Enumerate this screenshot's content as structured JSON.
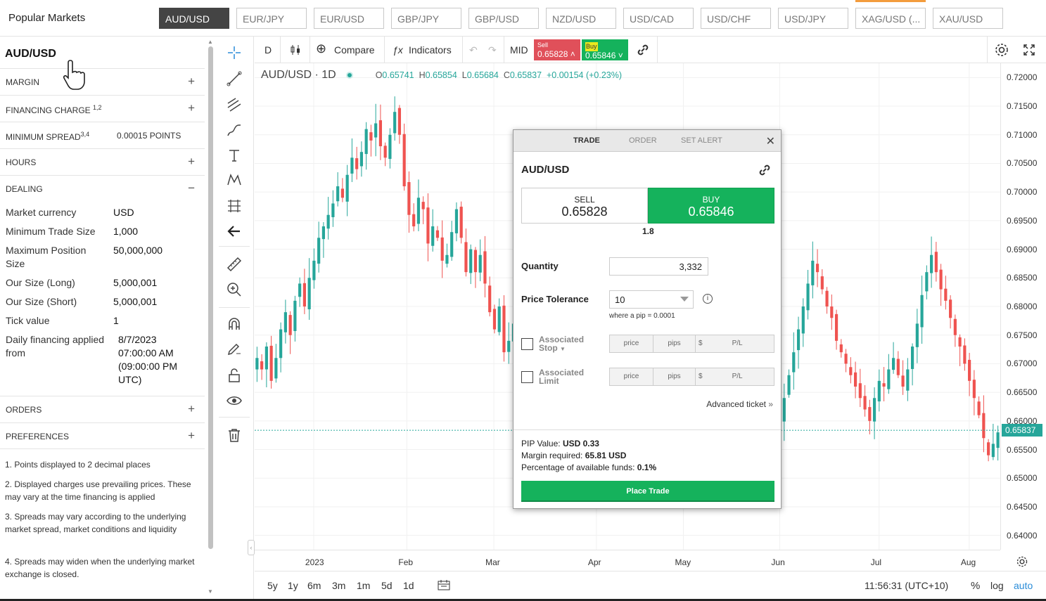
{
  "header": {
    "title": "Popular Markets",
    "tabs": [
      "AUD/USD",
      "EUR/JPY",
      "EUR/USD",
      "GBP/JPY",
      "GBP/USD",
      "NZD/USD",
      "USD/CAD",
      "USD/CHF",
      "USD/JPY",
      "XAG/USD (...",
      "XAU/USD"
    ],
    "active_tab": "AUD/USD"
  },
  "sidebar": {
    "market": "AUD/USD",
    "sections": {
      "margin": "MARGIN",
      "financing": "FINANCING CHARGE",
      "financing_sup": "1,2",
      "min_spread": "MINIMUM SPREAD",
      "min_spread_sup": "3,4",
      "min_spread_value": "0.00015 POINTS",
      "hours": "HOURS",
      "dealing": "DEALING",
      "orders": "ORDERS",
      "preferences": "PREFERENCES"
    },
    "dealing_rows": [
      {
        "k": "Market currency",
        "v": "USD"
      },
      {
        "k": "Minimum Trade Size",
        "v": "1,000"
      },
      {
        "k": "Maximum Position Size",
        "v": "50,000,000"
      },
      {
        "k": "Our Size (Long)",
        "v": "5,000,001"
      },
      {
        "k": "Our Size (Short)",
        "v": "5,000,001"
      },
      {
        "k": "Tick value",
        "v": "1"
      },
      {
        "k": "Daily financing applied from",
        "v": "8/7/2023 07:00:00 AM (09:00:00 PM UTC)"
      }
    ],
    "footnotes": [
      "1. Points displayed to 2 decimal places",
      "2. Displayed charges use prevailing prices. These may vary at the time financing is applied",
      "3. Spreads may vary according to the underlying market spread, market conditions and liquidity",
      "4. Spreads may widen when the underlying market exchange is closed."
    ]
  },
  "chart_toolbar": {
    "interval": "D",
    "compare": "Compare",
    "indicators": "Indicators",
    "mid": "MID",
    "sell_label": "Sell",
    "sell_price": "0.65828",
    "buy_label": "Buy",
    "buy_price": "0.65846"
  },
  "legend": {
    "symbol": "AUD/USD · 1D",
    "o_label": "O",
    "o": "0.65741",
    "h_label": "H",
    "h": "0.65854",
    "l_label": "L",
    "l": "0.65684",
    "c_label": "C",
    "c": "0.65837",
    "change": "+0.00154 (+0.23%)"
  },
  "colors": {
    "up": "#26a69a",
    "down": "#ef5350",
    "buy": "#15b25c",
    "sell": "#e0505a"
  },
  "chart_data": {
    "type": "candlestick",
    "x_range": [
      "2022-12-14",
      "2023-08-11"
    ],
    "ylim": [
      0.6375,
      0.7225
    ],
    "y_ticks": [
      "0.72000",
      "0.71500",
      "0.71000",
      "0.70500",
      "0.70000",
      "0.69500",
      "0.69000",
      "0.68500",
      "0.68000",
      "0.67500",
      "0.67000",
      "0.66500",
      "0.66000",
      "0.65500",
      "0.65000",
      "0.64500",
      "0.64000"
    ],
    "x_ticks": [
      {
        "label": "2023",
        "date": "2023-01-02"
      },
      {
        "label": "Feb",
        "date": "2023-02-01"
      },
      {
        "label": "Mar",
        "date": "2023-03-01"
      },
      {
        "label": "Apr",
        "date": "2023-04-03"
      },
      {
        "label": "May",
        "date": "2023-05-01"
      },
      {
        "label": "Jun",
        "date": "2023-06-01"
      },
      {
        "label": "Jul",
        "date": "2023-07-03"
      },
      {
        "label": "Aug",
        "date": "2023-08-01"
      }
    ],
    "last_price": "0.65837",
    "closes": [
      0.671,
      0.669,
      0.673,
      0.667,
      0.671,
      0.676,
      0.679,
      0.675,
      0.681,
      0.684,
      0.68,
      0.685,
      0.688,
      0.692,
      0.694,
      0.696,
      0.698,
      0.701,
      0.699,
      0.703,
      0.706,
      0.704,
      0.707,
      0.711,
      0.709,
      0.712,
      0.708,
      0.706,
      0.71,
      0.714,
      0.71,
      0.701,
      0.696,
      0.694,
      0.699,
      0.697,
      0.691,
      0.694,
      0.692,
      0.688,
      0.689,
      0.693,
      0.697,
      0.692,
      0.686,
      0.69,
      0.686,
      0.689,
      0.684,
      0.679,
      0.676,
      0.68,
      0.672,
      0.674,
      0.677,
      0.673,
      0.67,
      0.669,
      0.667,
      0.669,
      0.666,
      0.664,
      0.665,
      0.662,
      0.66,
      0.664,
      0.668,
      0.667,
      0.671,
      0.67,
      0.672,
      0.675,
      0.669,
      0.671,
      0.673,
      0.669,
      0.667,
      0.665,
      0.664,
      0.662,
      0.661,
      0.664,
      0.666,
      0.668,
      0.671,
      0.674,
      0.672,
      0.669,
      0.666,
      0.663,
      0.66,
      0.662,
      0.659,
      0.663,
      0.665,
      0.668,
      0.665,
      0.662,
      0.659,
      0.656,
      0.653,
      0.656,
      0.659,
      0.661,
      0.658,
      0.654,
      0.652,
      0.651,
      0.653,
      0.656,
      0.66,
      0.664,
      0.668,
      0.672,
      0.676,
      0.68,
      0.684,
      0.688,
      0.686,
      0.683,
      0.68,
      0.678,
      0.674,
      0.672,
      0.67,
      0.668,
      0.666,
      0.664,
      0.662,
      0.66,
      0.664,
      0.667,
      0.666,
      0.669,
      0.671,
      0.668,
      0.666,
      0.669,
      0.673,
      0.677,
      0.682,
      0.686,
      0.689,
      0.686,
      0.683,
      0.681,
      0.678,
      0.675,
      0.673,
      0.67,
      0.667,
      0.664,
      0.661,
      0.657,
      0.654,
      0.656,
      0.658
    ],
    "ohlc_last": {
      "o": 0.65741,
      "h": 0.65854,
      "l": 0.65684,
      "c": 0.65837
    }
  },
  "axis": {
    "bottom_gear": "gear-icon"
  },
  "bottom": {
    "ranges": [
      "5y",
      "1y",
      "6m",
      "3m",
      "1m",
      "5d",
      "1d"
    ],
    "time": "11:56:31 (UTC+10)",
    "percent": "%",
    "log": "log",
    "auto": "auto"
  },
  "ticket": {
    "tabs": [
      "TRADE",
      "ORDER",
      "SET ALERT"
    ],
    "market": "AUD/USD",
    "sell_label": "SELL",
    "sell_price": "0.65828",
    "buy_label": "BUY",
    "buy_price": "0.65846",
    "spread": "1.8",
    "quantity_label": "Quantity",
    "quantity": "3,332",
    "tolerance_label": "Price Tolerance",
    "tolerance": "10",
    "pip_hint": "where a pip = 0.0001",
    "stop_label_1": "Associated",
    "stop_label_2": "Stop",
    "limit_label_1": "Associated",
    "limit_label_2": "Limit",
    "fields": [
      "price",
      "pips",
      "$",
      "P/L"
    ],
    "advanced": "Advanced ticket",
    "pip_value_label": "PIP Value:",
    "pip_value": "USD 0.33",
    "margin_label": "Margin required:",
    "margin": "65.81 USD",
    "funds_label": "Percentage of available funds:",
    "funds": "0.1%",
    "place": "Place Trade"
  }
}
